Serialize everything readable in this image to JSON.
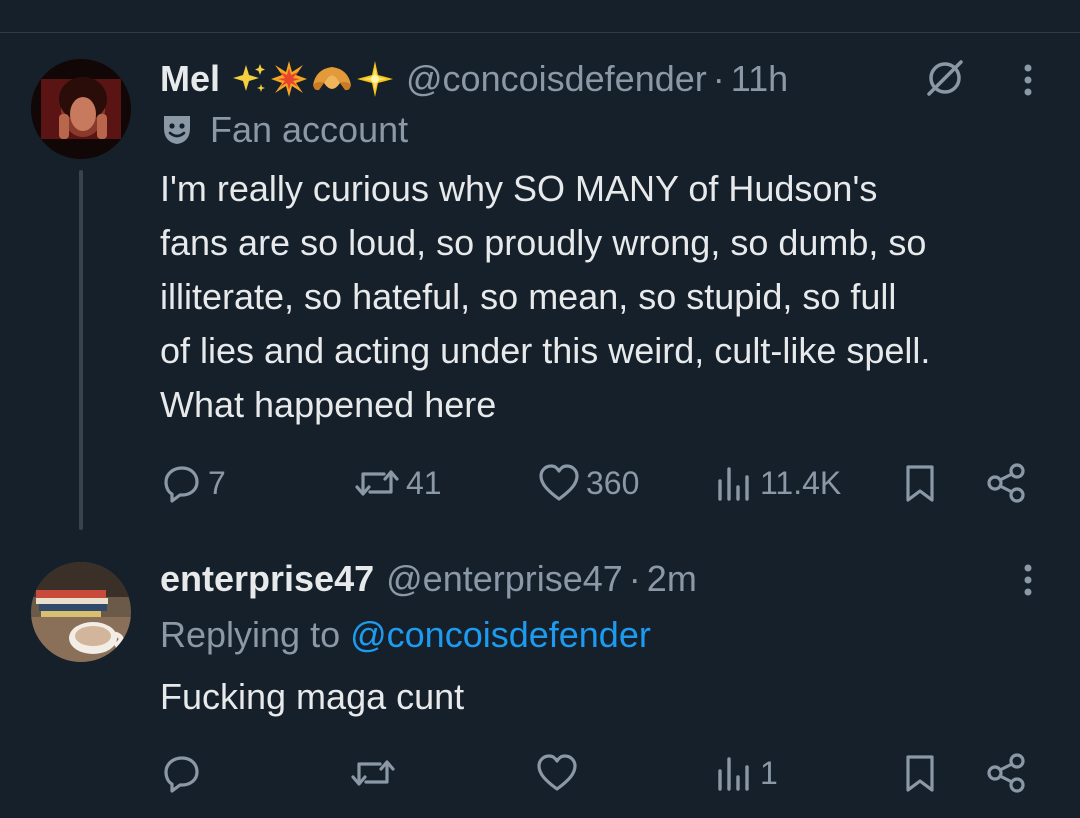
{
  "colors": {
    "background": "#15202b",
    "text_primary": "#e7e9ea",
    "text_secondary": "#8b98a5",
    "link": "#1d9bf0",
    "thread_line": "#38444d"
  },
  "tweet1": {
    "display_name": "Mel",
    "emojis": [
      "sparkles-emoji",
      "collision-emoji",
      "croissant-emoji",
      "glowing-star-emoji"
    ],
    "handle": "@concoisdefender",
    "separator": "·",
    "time": "11h",
    "label": "Fan account",
    "text": "I'm really curious why SO MANY of Hudson's\nfans are so loud, so proudly wrong, so dumb, so\nilliterate, so hateful, so mean, so stupid, so full\nof lies and acting under this weird, cult-like spell.\nWhat happened here",
    "replies": "7",
    "reposts": "41",
    "likes": "360",
    "views": "11.4K"
  },
  "tweet2": {
    "display_name": "enterprise47",
    "handle": "@enterprise47",
    "separator": "·",
    "time": "2m",
    "replying_prefix": "Replying to ",
    "replying_to": "@concoisdefender",
    "text": "Fucking maga cunt",
    "replies": "",
    "reposts": "",
    "likes": "",
    "views": "1"
  }
}
